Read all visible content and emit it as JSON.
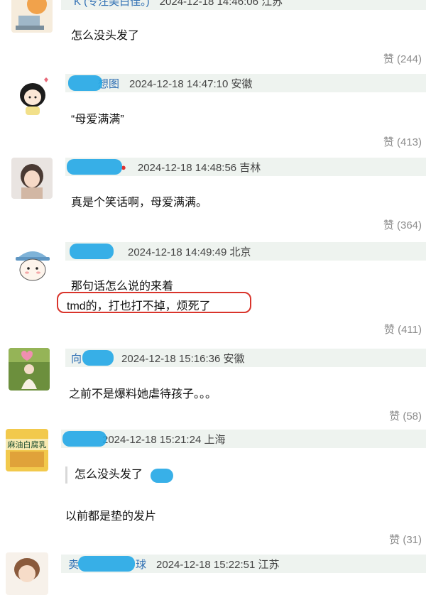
{
  "comments": [
    {
      "name": "K (专注美白佳。)",
      "time": "2024-12-18 14:46:06 江苏",
      "text": "怎么没头发了",
      "likes": "赞 (244)"
    },
    {
      "name": "想图",
      "time": "2024-12-18 14:47:10 安徽",
      "text": "“母爱满满”",
      "likes": "赞 (413)"
    },
    {
      "name": "",
      "time": "2024-12-18 14:48:56 吉林",
      "text": "真是个笑话啊，母爱满满。",
      "likes": "赞 (364)"
    },
    {
      "name": "",
      "time": "2024-12-18 14:49:49 北京",
      "text": "那句话怎么说的来着",
      "text2": "tmd的，打也打不掉，烦死了",
      "likes": "赞 (411)"
    },
    {
      "name": "向",
      "time": "2024-12-18 15:16:36 安徽",
      "text": "之前不是爆料她虐待孩子。。。",
      "likes": "赞 (58)"
    },
    {
      "name": "",
      "time": "2024-12-18 15:21:24 上海",
      "quote": "怎么没头发了",
      "text": "以前都是垫的发片",
      "likes": "赞 (31)",
      "avatar_text": "麻油白腐乳"
    },
    {
      "name": "卖",
      "name_suffix": "球",
      "time": "2024-12-18 15:22:51 江苏"
    }
  ],
  "colors": {
    "meta_bg": "#eef3ef",
    "name": "#2f6fb3",
    "highlight": "#d9342b",
    "scribble": "#27a9e6"
  }
}
